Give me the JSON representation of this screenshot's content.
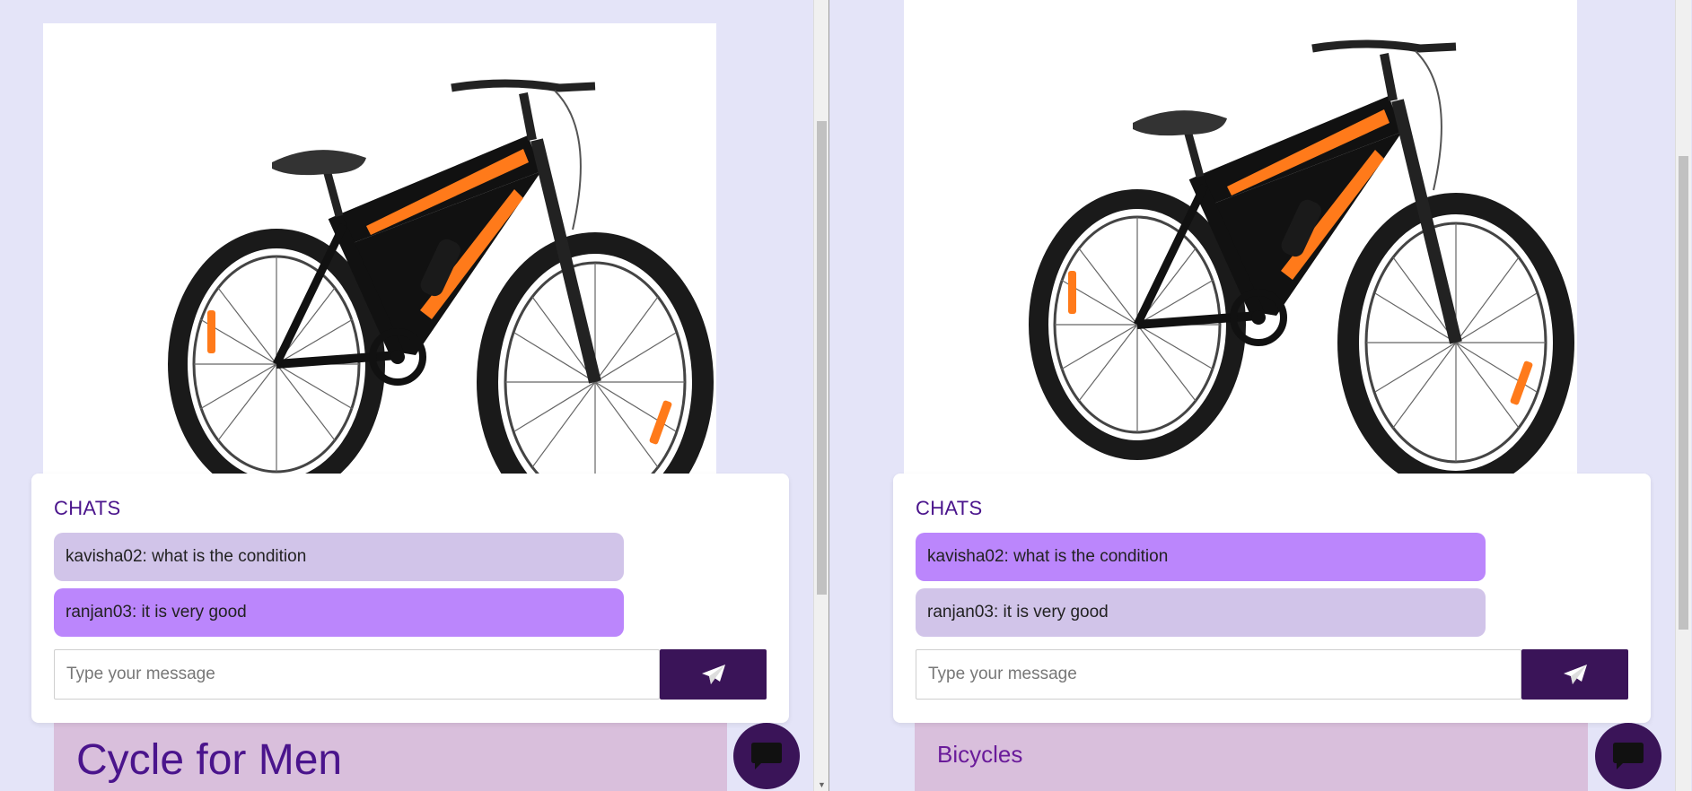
{
  "left": {
    "chat": {
      "title": "CHATS",
      "messages": [
        {
          "text": "kavisha02: what is the condition",
          "color": "#d1c4e9"
        },
        {
          "text": "ranjan03: it is very good",
          "color": "#bb86fc"
        }
      ],
      "input_placeholder": "Type your message",
      "send_icon": "paper-plane-icon"
    },
    "product": {
      "title": "Cycle for Men"
    },
    "fab_icon": "chat-bubble-icon"
  },
  "right": {
    "chat": {
      "title": "CHATS",
      "messages": [
        {
          "text": "kavisha02: what is the condition",
          "color": "#bb86fc"
        },
        {
          "text": "ranjan03: it is very good",
          "color": "#d1c4e9"
        }
      ],
      "input_placeholder": "Type your message",
      "send_icon": "paper-plane-icon"
    },
    "product": {
      "category": "Bicycles"
    },
    "fab_icon": "chat-bubble-icon"
  },
  "colors": {
    "page_bg": "#e4e4f8",
    "accent_dark": "#3a1458",
    "title_purple": "#4a148c",
    "info_card_bg": "#d9bfdc"
  }
}
